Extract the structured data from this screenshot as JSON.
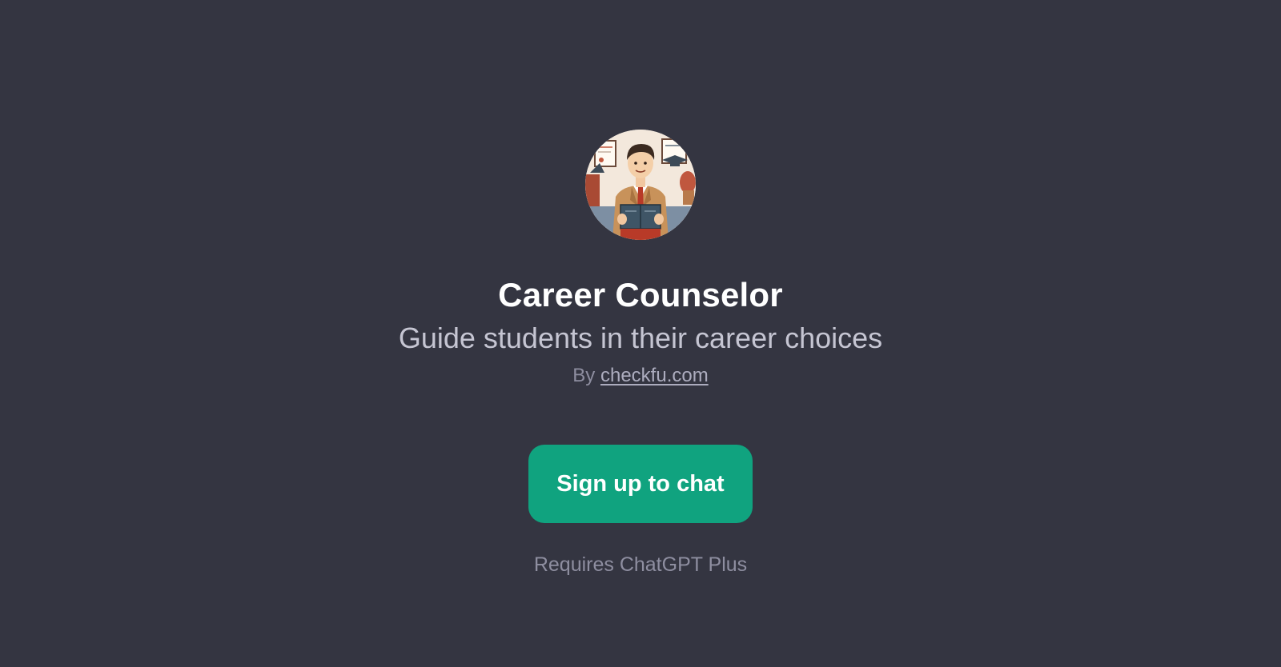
{
  "gpt": {
    "title": "Career Counselor",
    "description": "Guide students in their career choices",
    "author_prefix": "By",
    "author_link": "checkfu.com",
    "avatar_icon": "career-counselor-illustration"
  },
  "actions": {
    "signup_label": "Sign up to chat",
    "requirement_note": "Requires ChatGPT Plus"
  },
  "colors": {
    "background": "#343541",
    "accent": "#10a37f",
    "title": "#ffffff",
    "subtitle": "#c5c5d2",
    "muted": "#8e8ea0"
  }
}
